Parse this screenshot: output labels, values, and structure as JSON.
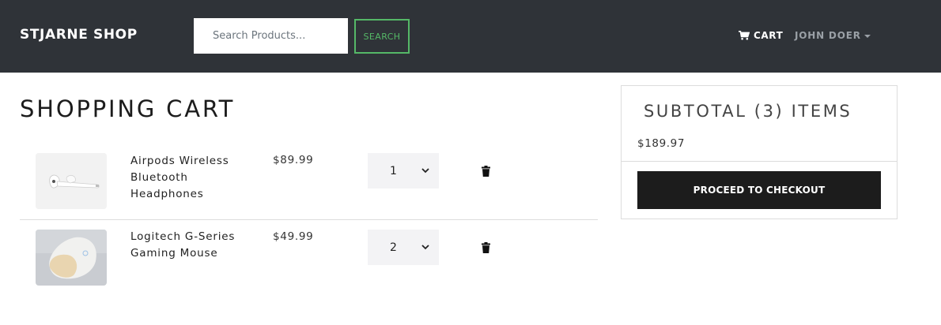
{
  "navbar": {
    "brand": "STJARNE SHOP",
    "search_placeholder": "Search Products...",
    "search_button": "SEARCH",
    "cart_label": "CART",
    "user_label": "JOHN DOER"
  },
  "page": {
    "title": "SHOPPING CART"
  },
  "cart": {
    "items": [
      {
        "name": "Airpods Wireless Bluetooth Headphones",
        "price": "$89.99",
        "qty": "1",
        "image_icon": "airpods-image"
      },
      {
        "name": "Logitech G-Series Gaming Mouse",
        "price": "$49.99",
        "qty": "2",
        "image_icon": "gaming-mouse-image"
      }
    ]
  },
  "summary": {
    "title": "SUBTOTAL (3) ITEMS",
    "amount": "$189.97",
    "checkout_button": "PROCEED TO CHECKOUT"
  },
  "colors": {
    "navbar_bg": "#2f3338",
    "search_accent": "#55b867",
    "checkout_bg": "#1c1c1c"
  }
}
